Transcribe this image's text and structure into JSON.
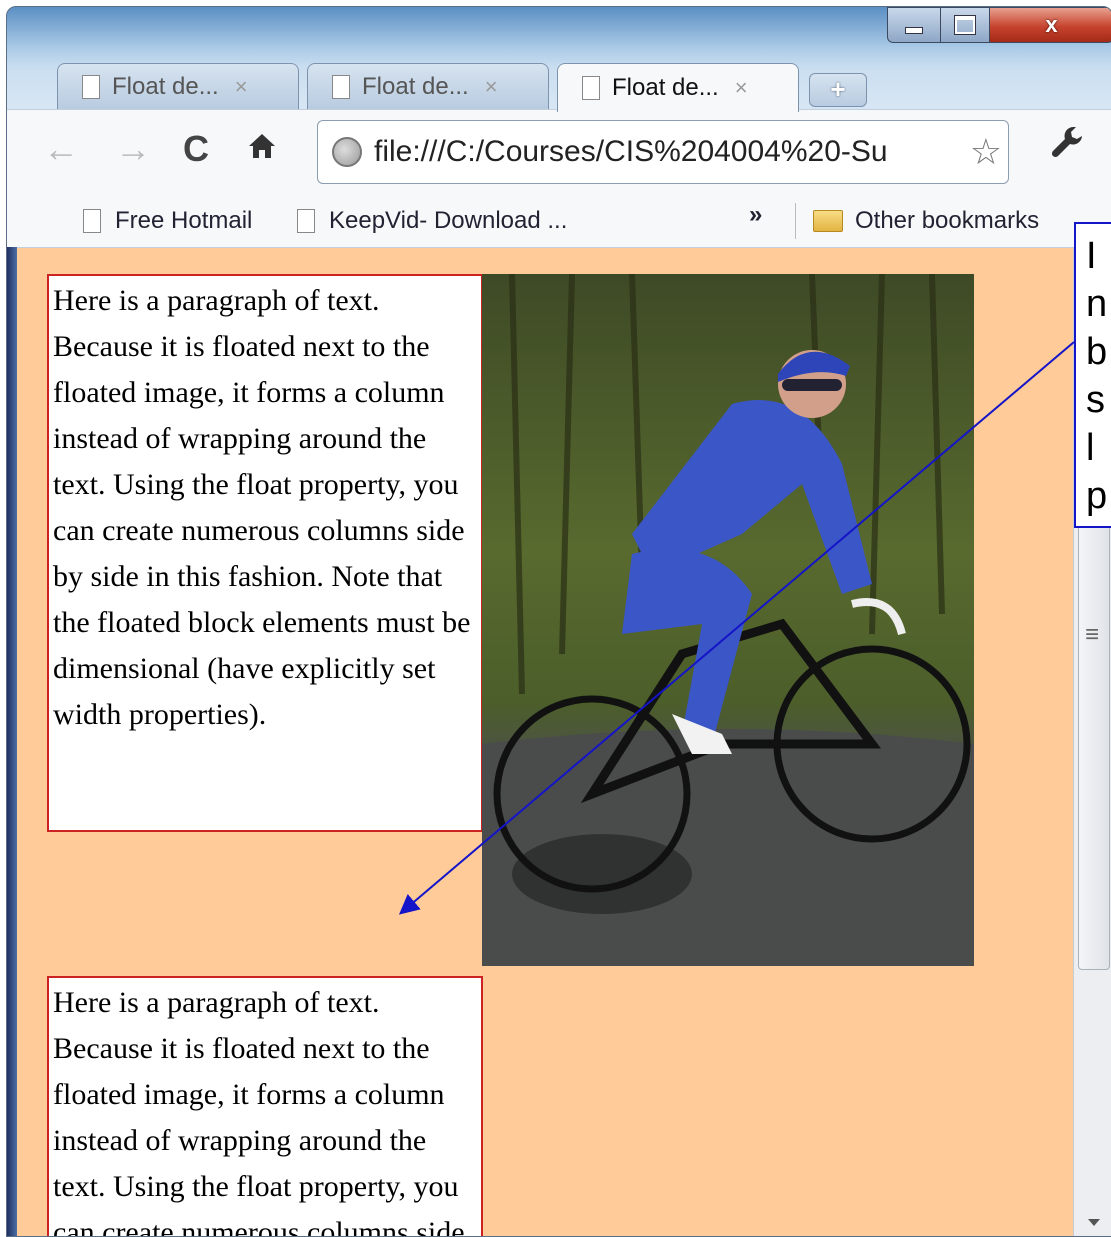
{
  "window": {
    "controls": {
      "minimize": "",
      "maximize": "",
      "close": "x"
    }
  },
  "tabs": [
    {
      "label": "Float de...",
      "close": "×",
      "active": false
    },
    {
      "label": "Float de...",
      "close": "×",
      "active": false
    },
    {
      "label": "Float de...",
      "close": "×",
      "active": true
    }
  ],
  "new_tab": "+",
  "toolbar": {
    "back": "←",
    "forward": "→",
    "reload": "C",
    "home": "🏠",
    "url": "file:///C:/Courses/CIS%204004%20-Su",
    "star": "☆",
    "wrench": "🔧"
  },
  "bookmarks": {
    "items": [
      {
        "label": "Free Hotmail",
        "icon": "page-icon"
      },
      {
        "label": "KeepVid- Download ...",
        "icon": "page-icon"
      }
    ],
    "overflow": "»",
    "other": {
      "label": "Other bookmarks",
      "icon": "folder-icon"
    }
  },
  "page": {
    "paragraph1": "Here is a paragraph of text. Because it is floated next to the floated image, it forms a column instead of wrapping around the text. Using the float property, you can create numerous columns side by side in this fashion. Note that the floated block elements must be dimensional (have explicitly set width properties).",
    "paragraph2": "Here is a paragraph of text. Because it is floated next to the floated image, it forms a column instead of wrapping around the text. Using the float property, you can create numerous columns side by side in this fashion. Note that the floated block elements must be dimensional (have explicitly set width properties).",
    "image": "cyclist-photo"
  },
  "scrollbar": {
    "grip": "≡"
  },
  "callout": {
    "lines": [
      "I",
      "n",
      "b",
      "s",
      "l",
      "p"
    ]
  },
  "colors": {
    "page_background": "#ffcc99",
    "paragraph_border": "#cc2222",
    "callout_border": "#1414c8",
    "close_button": "#c6432e"
  }
}
